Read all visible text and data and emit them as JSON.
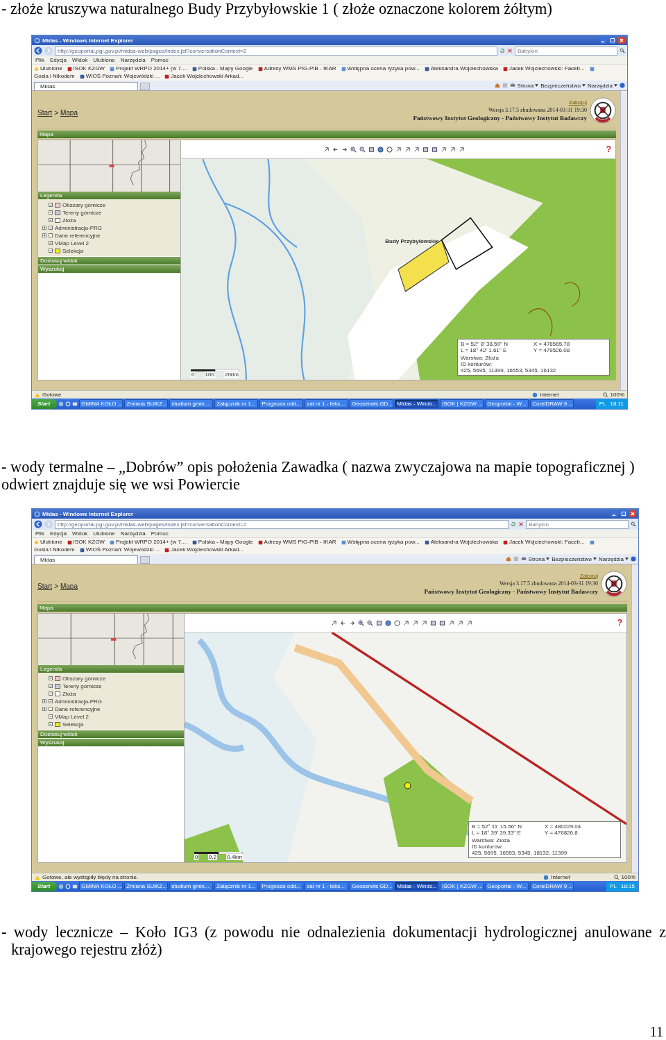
{
  "blocks": [
    {
      "kind": "paragraph",
      "text": "- złoże kruszywa naturalnego Budy Przybyłowskie 1 ( złoże oznaczone kolorem żółtym)"
    },
    {
      "kind": "screenshot",
      "window": {
        "title": "Midas - Windows Internet Explorer",
        "address": "http://geoportal.pgi.gov.pl/midas-web/pages/index.jsf?conversationContext=2",
        "search_placeholder": "Babylon",
        "menu": [
          "Plik",
          "Edycja",
          "Widok",
          "Ulubione",
          "Narzędzia",
          "Pomoc"
        ],
        "favorites": [
          "Ulubione",
          "ISOK KZGW",
          "Projekt WRPO 2014+ (w 7....",
          "Polska - Mapy Google",
          "Adresy WMS PIG-PIB - IKAR",
          "Wstępna ocena ryzyka pow...",
          "Aleksandra Wojciechowska",
          "Jacek Wojciechowski: Faceb...",
          "Gosia i Nikodem",
          "WIOŚ Poznań: Wojewódzki ...",
          "Jacek Wojciechowski Arkad..."
        ],
        "tab": "Midas",
        "commands": [
          "Strona",
          "Bezpieczeństwo",
          "Narzędzia"
        ]
      },
      "page": {
        "breadcrumb": [
          "Start",
          "Mapa"
        ],
        "separator": ">",
        "login": "Zaloguj",
        "version": "Wersja 3.17.5 zbudowana 2014-03-31 19:30",
        "institute": "Państwowy Instytut Geologiczny - Państwowy Instytut Badawczy",
        "panel_title": "Mapa",
        "legend_title": "Legenda",
        "legend": [
          {
            "label": "Obszary górnicze",
            "checked": true,
            "expandable": false,
            "color": "#f4c6d0"
          },
          {
            "label": "Tereny górnicze",
            "checked": true,
            "expandable": false,
            "color": "#c9cce8"
          },
          {
            "label": "Złoża",
            "checked": true,
            "expandable": false,
            "color": "#ffffff"
          },
          {
            "label": "Administracja-PRG",
            "checked": true,
            "expandable": true
          },
          {
            "label": "Dane referencyjne",
            "checked": false,
            "expandable": true
          },
          {
            "label": "VMap Level 2",
            "checked": true,
            "expandable": false
          },
          {
            "label": "Selekcja",
            "checked": true,
            "expandable": false,
            "color": "#f2f200"
          }
        ],
        "sections": [
          "Dostosuj widok",
          "Wyszukaj"
        ],
        "help": "?",
        "map": {
          "kind": "forest",
          "label": "Budy Przybyłowskie",
          "scale": [
            "0",
            "100",
            "200m"
          ],
          "info": {
            "b": "B = 52° 8' 38.59'' N",
            "x": "X = 478565.78",
            "l": "L = 18° 42' 1.61'' E",
            "y": "Y = 479526.08",
            "layer": "Warstwa: Złoża",
            "ids_title": "ID konturów:",
            "ids": "425, 5695, 11399, 16553, 5345, 16132"
          }
        }
      },
      "status": {
        "text": "Gotowe",
        "zone": "Internet",
        "zoom": "100%"
      },
      "taskbar": {
        "start": "Start",
        "items": [
          {
            "label": "GMINA KOŁO ...",
            "selected": false
          },
          {
            "label": "Zmiana SUiKZ...",
            "selected": false
          },
          {
            "label": "studium gmin...",
            "selected": false
          },
          {
            "label": "Załącznik nr 1...",
            "selected": false
          },
          {
            "label": "Prognoza odd...",
            "selected": false
          },
          {
            "label": "zał nr 1 - teks...",
            "selected": false
          },
          {
            "label": "Geoserwis GD...",
            "selected": false
          },
          {
            "label": "Midas - Windo...",
            "selected": true
          },
          {
            "label": "ISOK | KZGW ...",
            "selected": false
          },
          {
            "label": "Geoportal - W...",
            "selected": false
          },
          {
            "label": "CorelDRAW 9 ...",
            "selected": false
          }
        ],
        "language": "PL",
        "clock": "18:11"
      }
    },
    {
      "kind": "paragraph",
      "text": "- wody termalne – „Dobrów” opis położenia Zawadka ( nazwa zwyczajowa na mapie topograficznej ) odwiert znajduje się we wsi Powiercie"
    },
    {
      "kind": "screenshot",
      "window": {
        "title": "Midas - Windows Internet Explorer",
        "address": "http://geoportal.pgi.gov.pl/midas-web/pages/index.jsf?conversationContext=2",
        "search_placeholder": "Babylon",
        "menu": [
          "Plik",
          "Edycja",
          "Widok",
          "Ulubione",
          "Narzędzia",
          "Pomoc"
        ],
        "favorites": [
          "Ulubione",
          "ISOK KZGW",
          "Projekt WRPO 2014+ (w 7....",
          "Polska - Mapy Google",
          "Adresy WMS PIG-PIB - IKAR",
          "Wstępna ocena ryzyka pow...",
          "Aleksandra Wojciechowska",
          "Jacek Wojciechowski: Faceb...",
          "Gosia i Nikodem",
          "WIOŚ Poznań: Wojewódzki ...",
          "Jacek Wojciechowski Arkad..."
        ],
        "tab": "Midas",
        "commands": [
          "Strona",
          "Bezpieczeństwo",
          "Narzędzia"
        ]
      },
      "page": {
        "breadcrumb": [
          "Start",
          "Mapa"
        ],
        "separator": ">",
        "login": "Zaloguj",
        "version": "Wersja 3.17.5 zbudowana 2014-03-31 19:30",
        "institute": "Państwowy Instytut Geologiczny - Państwowy Instytut Badawczy",
        "panel_title": "Mapa",
        "legend_title": "Legenda",
        "legend": [
          {
            "label": "Obszary górnicze",
            "checked": true,
            "expandable": false,
            "color": "#f4c6d0"
          },
          {
            "label": "Tereny górnicze",
            "checked": true,
            "expandable": false,
            "color": "#c9cce8"
          },
          {
            "label": "Złoża",
            "checked": true,
            "expandable": false,
            "color": "#ffffff"
          },
          {
            "label": "Administracja-PRG",
            "checked": true,
            "expandable": true
          },
          {
            "label": "Dane referencyjne",
            "checked": false,
            "expandable": true
          },
          {
            "label": "VMap Level 2",
            "checked": true,
            "expandable": false
          },
          {
            "label": "Selekcja",
            "checked": true,
            "expandable": false,
            "color": "#f2f200"
          }
        ],
        "sections": [
          "Dostosuj widok",
          "Wyszukaj"
        ],
        "help": "?",
        "map": {
          "kind": "river",
          "scale": [
            "0",
            "0,2",
            "0,4km"
          ],
          "info": {
            "b": "B = 52° 11' 15.56'' N",
            "x": "X = 480229.04",
            "l": "L = 18° 39' 39.33'' E",
            "y": "Y = 476826.8",
            "layer": "Warstwa: Złoża",
            "ids_title": "ID konturów:",
            "ids": "425, 5695, 16553, 5345, 18132, 11399"
          }
        }
      },
      "status": {
        "text": "Gotowe, ale wystąpiły błędy na stronie.",
        "zone": "Internet",
        "zoom": "100%"
      },
      "taskbar": {
        "start": "Start",
        "items": [
          {
            "label": "GMINA KOŁO ...",
            "selected": false
          },
          {
            "label": "Zmiana SUiKZ...",
            "selected": false
          },
          {
            "label": "studium gmin...",
            "selected": false
          },
          {
            "label": "Załącznik nr 1...",
            "selected": false
          },
          {
            "label": "Prognoza odd...",
            "selected": false
          },
          {
            "label": "zał nr 1 - teks...",
            "selected": false
          },
          {
            "label": "Geoserwis GD...",
            "selected": false
          },
          {
            "label": "Midas - Windo...",
            "selected": true
          },
          {
            "label": "ISOK | KZGW ...",
            "selected": false
          },
          {
            "label": "Geoportal - W...",
            "selected": false
          },
          {
            "label": "CorelDRAW 9 ...",
            "selected": false
          }
        ],
        "language": "PL",
        "clock": "18:15"
      }
    },
    {
      "kind": "paragraph",
      "text": "- wody lecznicze – Koło IG3 (z powodu nie odnalezienia dokumentacji hydrologicznej anulowane z krajowego rejestru złóż)"
    }
  ],
  "page_number": "11"
}
